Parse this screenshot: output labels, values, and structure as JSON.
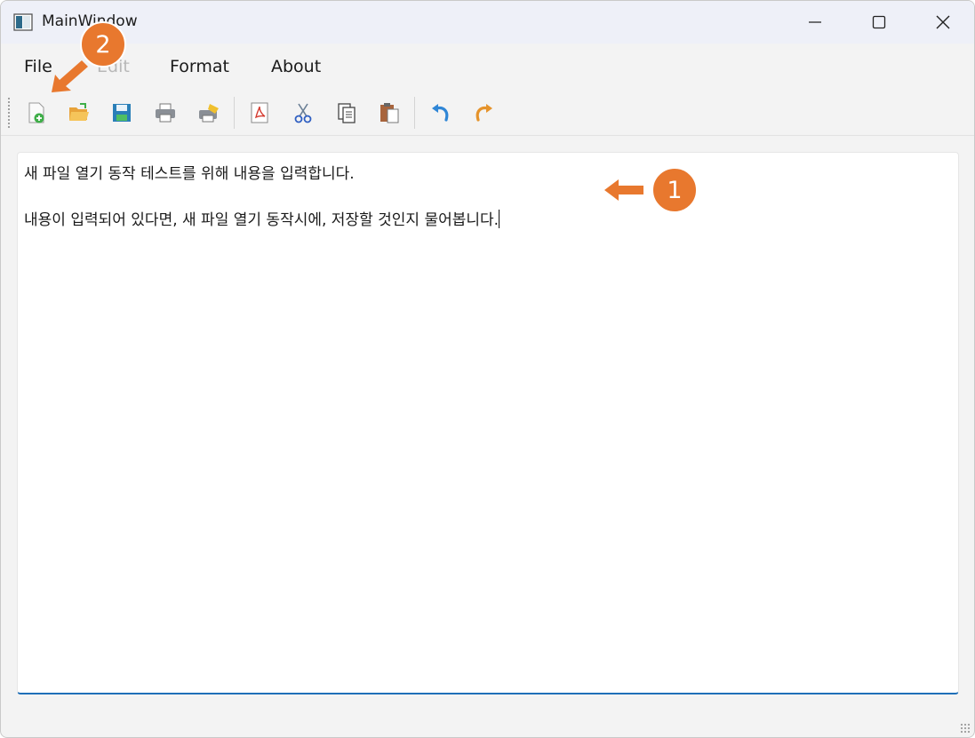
{
  "window": {
    "title": "MainWindow"
  },
  "menu": {
    "file": "File",
    "edit": "Edit",
    "format": "Format",
    "about": "About"
  },
  "toolbar": {
    "icons": [
      "new-file-icon",
      "open-folder-icon",
      "save-icon",
      "print-icon",
      "print-preview-icon",
      "pdf-export-icon",
      "cut-icon",
      "copy-icon",
      "paste-icon",
      "undo-icon",
      "redo-icon"
    ]
  },
  "editor": {
    "line1": "새 파일 열기 동작 테스트를 위해 내용을 입력합니다.",
    "line2": "내용이 입력되어 있다면, 새 파일 열기 동작시에, 저장할 것인지 물어봅니다."
  },
  "annotations": {
    "badge1": "1",
    "badge2": "2"
  },
  "colors": {
    "annotation": "#e8782e",
    "focus_underline": "#1f6fb8"
  }
}
